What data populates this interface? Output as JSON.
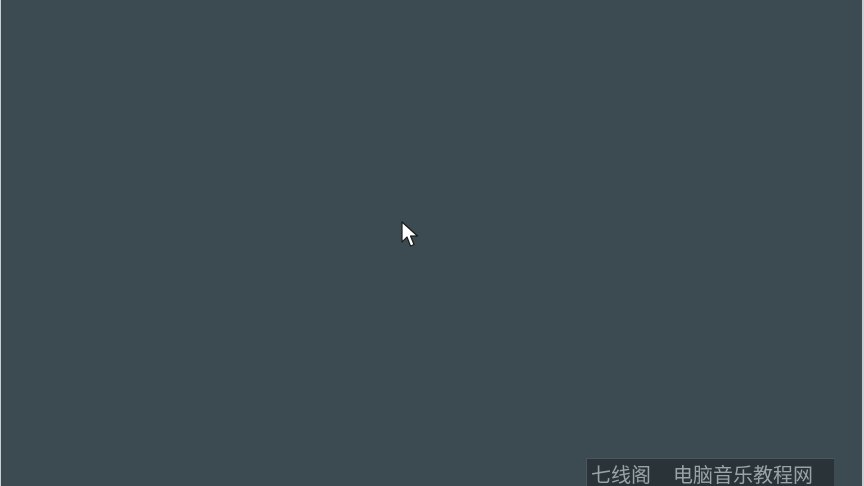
{
  "window": {
    "background": "#3b4b51"
  },
  "cursor": {
    "icon": "arrow-cursor-icon",
    "color": "#ffffff"
  },
  "watermark": {
    "left_text": "七线阁",
    "right_text": "电脑音乐教程网"
  }
}
